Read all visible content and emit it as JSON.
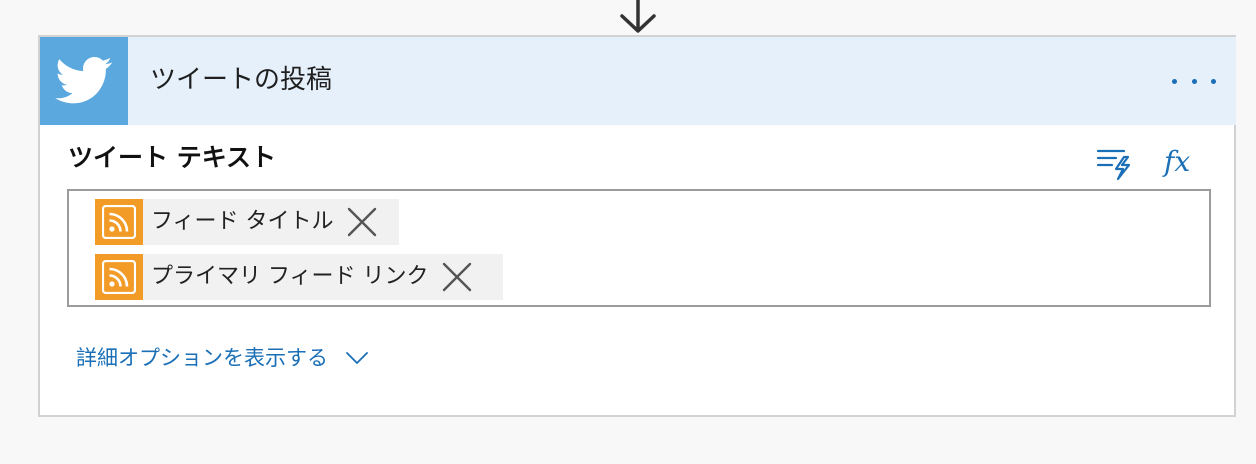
{
  "colors": {
    "header_bg": "#e5f0fa",
    "brand_tile": "#5aa8de",
    "accent": "#1a6fb6",
    "rss": "#f29b27"
  },
  "card": {
    "title": "ツイートの投稿",
    "brand_icon": "twitter-bird-icon",
    "menu_icon": "more-options-icon"
  },
  "field": {
    "label": "ツイート テキスト",
    "tools": {
      "dynamic_content_icon": "dynamic-content-icon",
      "expression_label": "fx"
    },
    "tokens": [
      {
        "label": "フィード タイトル",
        "icon": "rss-icon"
      },
      {
        "label": "プライマリ フィード リンク",
        "icon": "rss-icon"
      }
    ]
  },
  "advanced": {
    "label": "詳細オプションを表示する",
    "icon": "chevron-down-icon"
  }
}
